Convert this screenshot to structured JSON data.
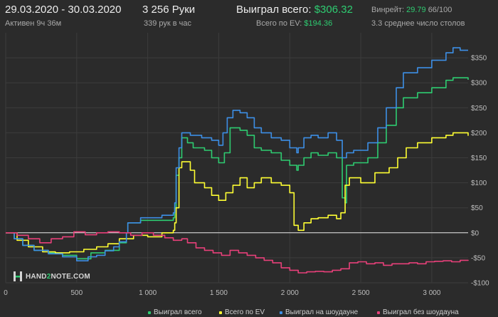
{
  "header": {
    "date_range": "29.03.2020 - 30.03.2020",
    "active": "Активен 9ч 36м",
    "hands": "3 256 Руки",
    "per_hour": "339 рук в час",
    "won_total_label": "Выиграл всего:",
    "won_total_value": "$306.32",
    "ev_label": "Всего по EV:",
    "ev_value": "$194.36",
    "winrate_label": "Винрейт:",
    "winrate_value": "29.79",
    "winrate_count": "66/100",
    "tables_text": "3.3 среднее число столов"
  },
  "logo": {
    "text_a": "HAND",
    "text_b": "2",
    "text_c": "NOTE.COM"
  },
  "colors": {
    "background": "#2b2b2b",
    "won_total": "#2ecc71",
    "ev": "#ffff33",
    "showdown": "#3d8fe6",
    "non_showdown": "#e8407a"
  },
  "chart_data": {
    "type": "line",
    "xlim": [
      0,
      3256
    ],
    "ylim": [
      -100,
      400
    ],
    "x_ticks": [
      0,
      500,
      1000,
      1500,
      2000,
      2500,
      3000
    ],
    "x_tick_labels": [
      "0",
      "500",
      "1 000",
      "1 500",
      "2 000",
      "2 500",
      "3 000"
    ],
    "y_ticks": [
      -100,
      -50,
      0,
      50,
      100,
      150,
      200,
      250,
      300,
      350
    ],
    "y_tick_labels": [
      "-$100",
      "-$50",
      "$0",
      "$50",
      "$100",
      "$150",
      "$200",
      "$250",
      "$300",
      "$350"
    ],
    "grid": true,
    "legend": "bottom",
    "series": [
      {
        "name": "Выиграл всего",
        "color": "#2ecc71",
        "points": [
          [
            0,
            0
          ],
          [
            60,
            -12
          ],
          [
            120,
            -25
          ],
          [
            200,
            -35
          ],
          [
            300,
            -40
          ],
          [
            400,
            -45
          ],
          [
            500,
            -52
          ],
          [
            600,
            -40
          ],
          [
            700,
            -35
          ],
          [
            800,
            -20
          ],
          [
            850,
            0
          ],
          [
            860,
            20
          ],
          [
            950,
            25
          ],
          [
            1100,
            25
          ],
          [
            1180,
            30
          ],
          [
            1190,
            50
          ],
          [
            1200,
            115
          ],
          [
            1220,
            150
          ],
          [
            1240,
            190
          ],
          [
            1280,
            180
          ],
          [
            1320,
            170
          ],
          [
            1400,
            165
          ],
          [
            1450,
            150
          ],
          [
            1500,
            140
          ],
          [
            1540,
            160
          ],
          [
            1580,
            210
          ],
          [
            1650,
            205
          ],
          [
            1700,
            195
          ],
          [
            1750,
            170
          ],
          [
            1800,
            165
          ],
          [
            1870,
            160
          ],
          [
            1940,
            145
          ],
          [
            2000,
            135
          ],
          [
            2050,
            125
          ],
          [
            2060,
            135
          ],
          [
            2100,
            150
          ],
          [
            2150,
            160
          ],
          [
            2200,
            155
          ],
          [
            2270,
            160
          ],
          [
            2330,
            150
          ],
          [
            2370,
            70
          ],
          [
            2390,
            60
          ],
          [
            2400,
            135
          ],
          [
            2450,
            140
          ],
          [
            2550,
            150
          ],
          [
            2620,
            180
          ],
          [
            2680,
            215
          ],
          [
            2750,
            250
          ],
          [
            2800,
            270
          ],
          [
            2900,
            280
          ],
          [
            3000,
            290
          ],
          [
            3100,
            305
          ],
          [
            3150,
            310
          ],
          [
            3256,
            306
          ]
        ]
      },
      {
        "name": "Всего по EV",
        "color": "#ffff33",
        "points": [
          [
            0,
            0
          ],
          [
            80,
            -15
          ],
          [
            160,
            -28
          ],
          [
            260,
            -38
          ],
          [
            350,
            -40
          ],
          [
            450,
            -38
          ],
          [
            550,
            -33
          ],
          [
            640,
            -28
          ],
          [
            720,
            -22
          ],
          [
            800,
            -12
          ],
          [
            900,
            -5
          ],
          [
            1000,
            -8
          ],
          [
            1100,
            0
          ],
          [
            1180,
            5
          ],
          [
            1190,
            20
          ],
          [
            1200,
            50
          ],
          [
            1220,
            130
          ],
          [
            1240,
            142
          ],
          [
            1300,
            125
          ],
          [
            1330,
            100
          ],
          [
            1400,
            90
          ],
          [
            1450,
            75
          ],
          [
            1500,
            65
          ],
          [
            1550,
            80
          ],
          [
            1600,
            95
          ],
          [
            1650,
            110
          ],
          [
            1700,
            90
          ],
          [
            1750,
            100
          ],
          [
            1800,
            110
          ],
          [
            1870,
            100
          ],
          [
            1940,
            95
          ],
          [
            2000,
            80
          ],
          [
            2030,
            15
          ],
          [
            2060,
            5
          ],
          [
            2100,
            20
          ],
          [
            2150,
            28
          ],
          [
            2200,
            30
          ],
          [
            2270,
            35
          ],
          [
            2330,
            28
          ],
          [
            2360,
            40
          ],
          [
            2390,
            95
          ],
          [
            2420,
            110
          ],
          [
            2500,
            100
          ],
          [
            2600,
            120
          ],
          [
            2700,
            130
          ],
          [
            2760,
            150
          ],
          [
            2820,
            170
          ],
          [
            2900,
            180
          ],
          [
            3000,
            190
          ],
          [
            3100,
            195
          ],
          [
            3150,
            200
          ],
          [
            3256,
            194
          ]
        ]
      },
      {
        "name": "Выиграл на шоудауне",
        "color": "#3d8fe6",
        "points": [
          [
            0,
            0
          ],
          [
            60,
            -12
          ],
          [
            120,
            -25
          ],
          [
            200,
            -35
          ],
          [
            300,
            -42
          ],
          [
            400,
            -48
          ],
          [
            500,
            -56
          ],
          [
            580,
            -48
          ],
          [
            640,
            -45
          ],
          [
            700,
            -36
          ],
          [
            760,
            -28
          ],
          [
            800,
            -18
          ],
          [
            850,
            0
          ],
          [
            860,
            20
          ],
          [
            950,
            30
          ],
          [
            1100,
            35
          ],
          [
            1180,
            40
          ],
          [
            1190,
            60
          ],
          [
            1200,
            130
          ],
          [
            1220,
            170
          ],
          [
            1240,
            200
          ],
          [
            1300,
            195
          ],
          [
            1380,
            190
          ],
          [
            1450,
            185
          ],
          [
            1500,
            175
          ],
          [
            1530,
            200
          ],
          [
            1560,
            230
          ],
          [
            1600,
            245
          ],
          [
            1650,
            240
          ],
          [
            1700,
            230
          ],
          [
            1750,
            210
          ],
          [
            1800,
            200
          ],
          [
            1870,
            190
          ],
          [
            1940,
            185
          ],
          [
            2000,
            170
          ],
          [
            2050,
            160
          ],
          [
            2060,
            170
          ],
          [
            2100,
            190
          ],
          [
            2150,
            195
          ],
          [
            2200,
            190
          ],
          [
            2270,
            200
          ],
          [
            2330,
            185
          ],
          [
            2370,
            150
          ],
          [
            2400,
            160
          ],
          [
            2450,
            165
          ],
          [
            2550,
            180
          ],
          [
            2620,
            210
          ],
          [
            2680,
            250
          ],
          [
            2750,
            290
          ],
          [
            2800,
            320
          ],
          [
            2900,
            330
          ],
          [
            3000,
            345
          ],
          [
            3100,
            360
          ],
          [
            3150,
            370
          ],
          [
            3200,
            365
          ],
          [
            3256,
            365
          ]
        ]
      },
      {
        "name": "Выиграл без шоудауна",
        "color": "#e8407a",
        "points": [
          [
            0,
            0
          ],
          [
            80,
            -5
          ],
          [
            160,
            -12
          ],
          [
            240,
            -20
          ],
          [
            320,
            -12
          ],
          [
            400,
            -8
          ],
          [
            480,
            2
          ],
          [
            560,
            -4
          ],
          [
            640,
            0
          ],
          [
            720,
            2
          ],
          [
            800,
            0
          ],
          [
            880,
            -5
          ],
          [
            960,
            0
          ],
          [
            1040,
            -5
          ],
          [
            1120,
            -10
          ],
          [
            1180,
            -15
          ],
          [
            1240,
            -12
          ],
          [
            1280,
            -20
          ],
          [
            1340,
            -30
          ],
          [
            1400,
            -35
          ],
          [
            1460,
            -40
          ],
          [
            1520,
            -45
          ],
          [
            1580,
            -35
          ],
          [
            1640,
            -40
          ],
          [
            1700,
            -45
          ],
          [
            1760,
            -50
          ],
          [
            1820,
            -55
          ],
          [
            1880,
            -60
          ],
          [
            1940,
            -70
          ],
          [
            2000,
            -75
          ],
          [
            2060,
            -80
          ],
          [
            2120,
            -78
          ],
          [
            2180,
            -77
          ],
          [
            2240,
            -78
          ],
          [
            2300,
            -75
          ],
          [
            2360,
            -72
          ],
          [
            2420,
            -60
          ],
          [
            2480,
            -58
          ],
          [
            2540,
            -62
          ],
          [
            2600,
            -60
          ],
          [
            2660,
            -65
          ],
          [
            2720,
            -62
          ],
          [
            2780,
            -62
          ],
          [
            2840,
            -60
          ],
          [
            2900,
            -62
          ],
          [
            2960,
            -58
          ],
          [
            3020,
            -57
          ],
          [
            3080,
            -56
          ],
          [
            3140,
            -58
          ],
          [
            3200,
            -55
          ],
          [
            3256,
            -56
          ]
        ]
      }
    ]
  }
}
